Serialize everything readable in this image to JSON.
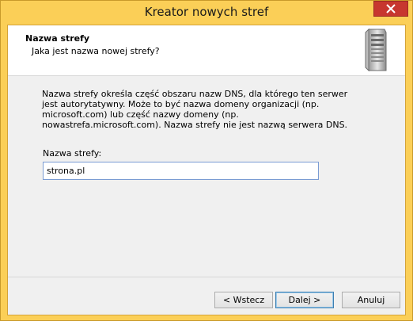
{
  "window": {
    "title": "Kreator nowych stref",
    "close_icon": "close-icon"
  },
  "header": {
    "title": "Nazwa strefy",
    "subtitle": "Jaka jest nazwa nowej strefy?",
    "icon": "server-icon"
  },
  "body": {
    "description": "Nazwa strefy określa część obszaru nazw DNS, dla którego ten serwer jest autorytatywny. Może to być nazwa domeny organizacji (np. microsoft.com) lub część nazwy domeny (np. nowastrefa.microsoft.com). Nazwa strefy nie jest nazwą serwera DNS.",
    "field_label": "Nazwa strefy:",
    "field_value": "strona.pl"
  },
  "buttons": {
    "back": "< Wstecz",
    "next": "Dalej >",
    "cancel": "Anuluj"
  },
  "colors": {
    "titlebar": "#fbcf57",
    "close_button": "#c7372f"
  }
}
